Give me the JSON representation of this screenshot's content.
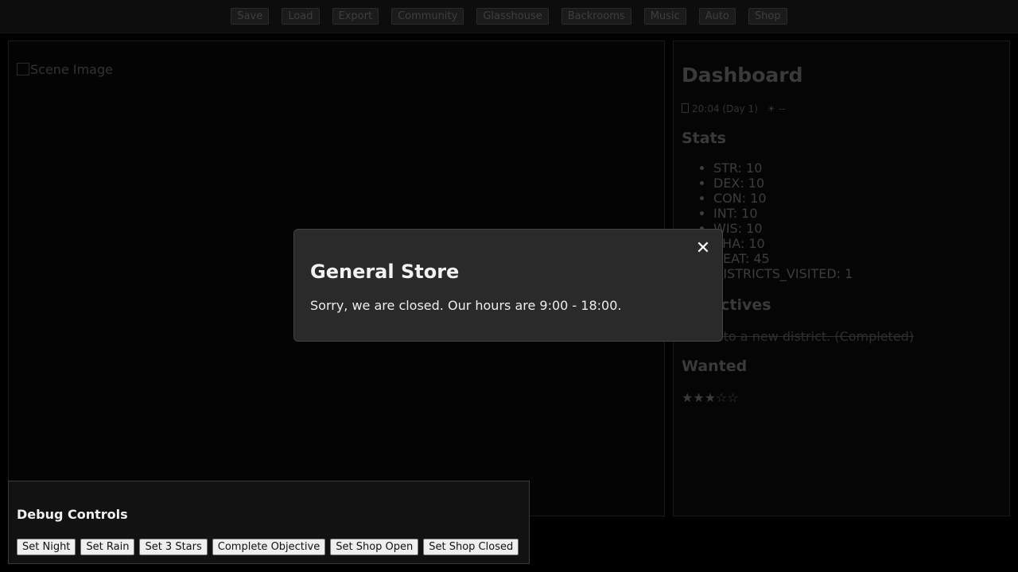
{
  "nav": {
    "buttons": [
      "Save",
      "Load",
      "Export",
      "Community",
      "Glasshouse",
      "Backrooms",
      "Music",
      "Auto",
      "Shop"
    ]
  },
  "scene": {
    "image_alt": "Scene Image"
  },
  "dashboard": {
    "title": "Dashboard",
    "time": "20:04 (Day 1)",
    "weather": "☀ --",
    "stats_heading": "Stats",
    "stats": [
      "STR: 10",
      "DEX: 10",
      "CON: 10",
      "INT: 10",
      "WIS: 10",
      "CHA: 10",
      "HEAT: 45",
      "DISTRICTS_VISITED: 1"
    ],
    "objectives_heading": "Objectives",
    "objective": "Travel to a new district. (Completed)",
    "wanted_heading": "Wanted",
    "wanted_stars": "★★★☆☆",
    "wanted_level": 3,
    "wanted_max": 5
  },
  "debug": {
    "title": "Debug Controls",
    "buttons": [
      "Set Night",
      "Set Rain",
      "Set 3 Stars",
      "Complete Objective",
      "Set Shop Open",
      "Set Shop Closed"
    ]
  },
  "modal": {
    "title": "General Store",
    "message": "Sorry, we are closed. Our hours are 9:00 - 18:00.",
    "close_glyph": "✕"
  }
}
